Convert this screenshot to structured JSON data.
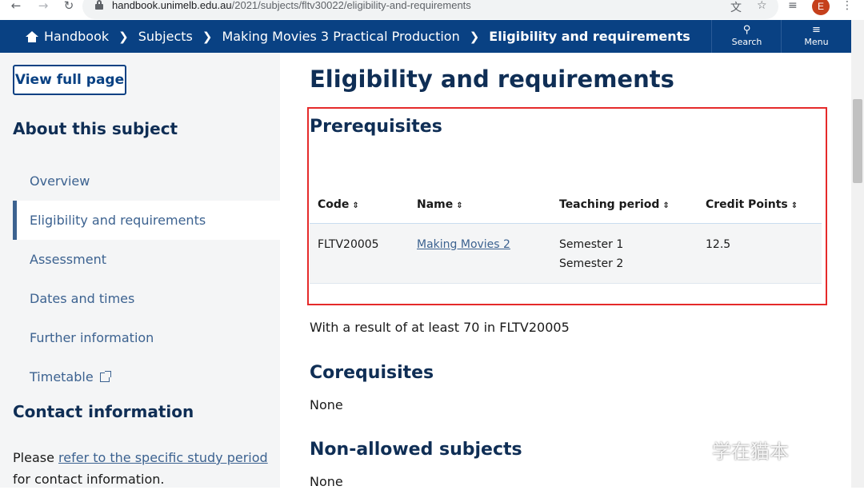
{
  "browser": {
    "url_host": "handbook.unimelb.edu.au",
    "url_path": "/2021/subjects/fltv30022/eligibility-and-requirements",
    "avatar_letter": "E"
  },
  "topnav": {
    "crumbs": [
      "Handbook",
      "Making Movies 3 Practical Production"
    ],
    "subjects": "Subjects",
    "current": "Eligibility and requirements",
    "search_label": "Search",
    "menu_label": "Menu",
    "color": "#094183"
  },
  "sidebar": {
    "view_full": "View full page",
    "about_heading": "About this subject",
    "items": [
      {
        "label": "Overview"
      },
      {
        "label": "Eligibility and requirements"
      },
      {
        "label": "Assessment"
      },
      {
        "label": "Dates and times"
      },
      {
        "label": "Further information"
      },
      {
        "label": "Timetable"
      }
    ],
    "contact_heading": "Contact information",
    "contact_prefix": "Please ",
    "contact_link": "refer to the specific study period",
    "contact_suffix": "for contact information."
  },
  "main": {
    "title": "Eligibility and requirements",
    "prerequisites_heading": "Prerequisites",
    "table": {
      "headers": [
        "Code",
        "Name",
        "Teaching period",
        "Credit Points"
      ],
      "rows": [
        {
          "code": "FLTV20005",
          "name": "Making Movies 2",
          "periods": [
            "Semester 1",
            "Semester 2"
          ],
          "credit": "12.5"
        }
      ]
    },
    "prereq_note": "With a result of at least 70 in FLTV20005",
    "corequisites_heading": "Corequisites",
    "corequisites_value": "None",
    "nonallowed_heading": "Non-allowed subjects",
    "nonallowed_value": "None"
  },
  "watermark": "学在猫本",
  "highlight_color": "#e52a2a"
}
